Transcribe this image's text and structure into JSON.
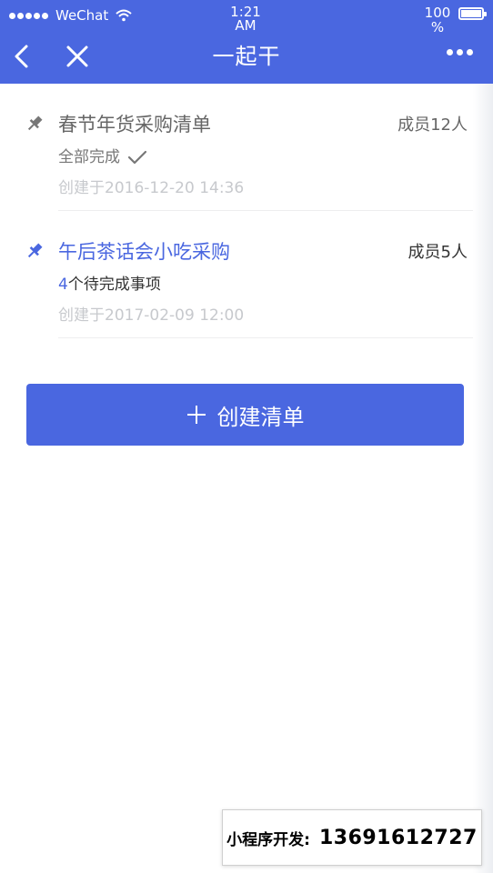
{
  "status_bar": {
    "carrier": "WeChat",
    "time": "1:21",
    "time_ampm": "AM",
    "battery_value": "100",
    "battery_unit": "%"
  },
  "nav": {
    "title": "一起干",
    "icons": [
      "back-icon",
      "close-icon",
      "more-icon"
    ]
  },
  "lists": [
    {
      "title": "春节年货采购清单",
      "members": "成员12人",
      "status": "全部完成",
      "created": "创建于2016-12-20 14:36"
    },
    {
      "title": "午后茶话会小吃采购",
      "members": "成员5人",
      "pending_count": "4",
      "pending_text": "个待完成事项",
      "created": "创建于2017-02-09 12:00"
    }
  ],
  "create_button": {
    "label": "创建清单"
  },
  "promo": {
    "label": "小程序开发:",
    "phone": "13691612727"
  },
  "colors": {
    "accent": "#4a67e0",
    "text_gray": "#666666",
    "text_light": "#c7c9cd"
  }
}
